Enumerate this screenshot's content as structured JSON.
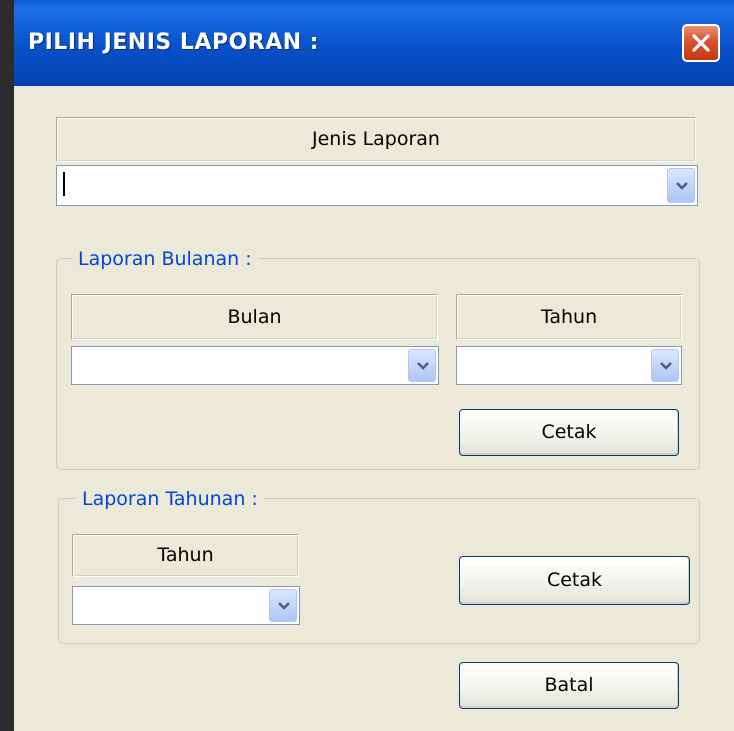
{
  "window": {
    "title": "PILIH JENIS LAPORAN :"
  },
  "jenis_laporan": {
    "label": "Jenis Laporan",
    "value": ""
  },
  "laporan_bulanan": {
    "legend": "Laporan Bulanan :",
    "bulan_label": "Bulan",
    "bulan_value": "",
    "tahun_label": "Tahun",
    "tahun_value": "",
    "cetak_label": "Cetak"
  },
  "laporan_tahunan": {
    "legend": "Laporan Tahunan :",
    "tahun_label": "Tahun",
    "tahun_value": "",
    "cetak_label": "Cetak"
  },
  "batal_label": "Batal",
  "icons": {
    "close": "close-icon",
    "dropdown": "chevron-down-icon"
  },
  "colors": {
    "title_bar": "#0851c9",
    "legend_text": "#0046d5",
    "dialog_bg": "#ece9d8",
    "close_button": "#d7532e"
  }
}
